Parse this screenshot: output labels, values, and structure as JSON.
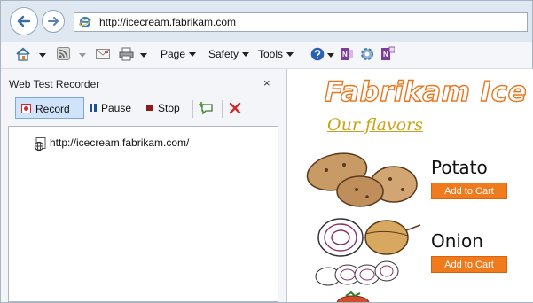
{
  "browser": {
    "url": "http://icecream.fabrikam.com"
  },
  "command_bar": {
    "page_label": "Page",
    "safety_label": "Safety",
    "tools_label": "Tools"
  },
  "recorder": {
    "title": "Web Test Recorder",
    "close_glyph": "×",
    "record_label": "Record",
    "pause_label": "Pause",
    "stop_label": "Stop",
    "tree_items": [
      {
        "label": "http://icecream.fabrikam.com/"
      }
    ]
  },
  "webpage": {
    "title": "Fabrikam Ice",
    "subtitle_link": "Our flavors",
    "products": [
      {
        "name": "Potato",
        "button": "Add to Cart"
      },
      {
        "name": "Onion",
        "button": "Add to Cart"
      }
    ]
  },
  "colors": {
    "accent_orange": "#f07a1c",
    "link_gold": "#caa21a",
    "record_red": "#d8262b",
    "pause_blue": "#1b4f9c",
    "stop_maroon": "#8e1b1b"
  }
}
